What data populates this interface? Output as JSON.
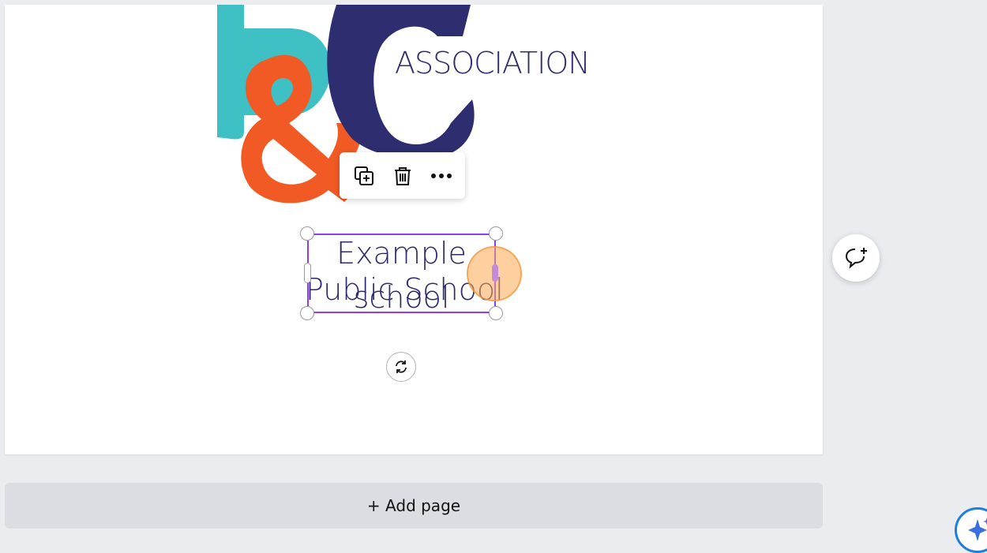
{
  "canvas": {
    "logo_text": "ASSOCIATION",
    "selected_text": {
      "line1": "Example",
      "line2": "Public School",
      "line3": "school"
    }
  },
  "toolbar": {
    "duplicate_icon": "duplicate-icon",
    "delete_icon": "trash-icon",
    "more_icon": "more-options-icon"
  },
  "footer": {
    "add_page_label": "+ Add page"
  },
  "side": {
    "comment_icon": "add-comment-icon",
    "magic_icon": "sparkle-icon"
  },
  "colors": {
    "teal": "#3ec0c4",
    "orange": "#f15a24",
    "navy": "#2d2d70",
    "selection": "#8b3dff"
  }
}
